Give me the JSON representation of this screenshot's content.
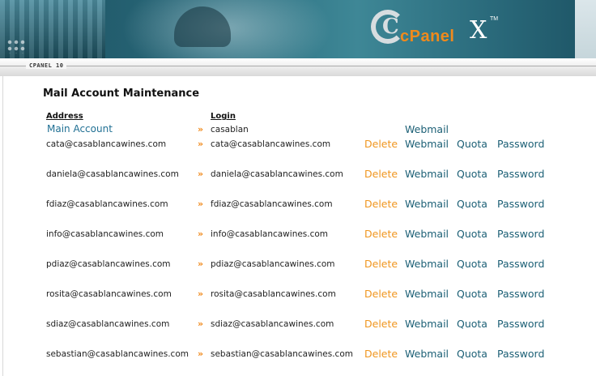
{
  "header": {
    "brand": "cPanel",
    "brand_mark": "C",
    "brand_version_mark": "X",
    "trademark": "TM",
    "version_label": "CPANEL 10"
  },
  "page": {
    "title": "Mail Account Maintenance",
    "col_address": "Address",
    "col_login": "Login"
  },
  "main_account": {
    "label": "Main Account",
    "arrow": "»",
    "login": "casablan",
    "webmail": "Webmail"
  },
  "actions": {
    "arrow": "»",
    "delete": "Delete",
    "webmail": "Webmail",
    "quota": "Quota",
    "password": "Password"
  },
  "accounts": [
    {
      "address": "cata@casablancawines.com",
      "login": "cata@casablancawines.com"
    },
    {
      "address": "daniela@casablancawines.com",
      "login": "daniela@casablancawines.com"
    },
    {
      "address": "fdiaz@casablancawines.com",
      "login": "fdiaz@casablancawines.com"
    },
    {
      "address": "info@casablancawines.com",
      "login": "info@casablancawines.com"
    },
    {
      "address": "pdiaz@casablancawines.com",
      "login": "pdiaz@casablancawines.com"
    },
    {
      "address": "rosita@casablancawines.com",
      "login": "rosita@casablancawines.com"
    },
    {
      "address": "sdiaz@casablancawines.com",
      "login": "sdiaz@casablancawines.com"
    },
    {
      "address": "sebastian@casablancawines.com",
      "login": "sebastian@casablancawines.com"
    }
  ],
  "colors": {
    "delete": "#f0961f",
    "link": "#1b5f75",
    "arrow": "#f08a1c",
    "banner": "#2a6b7c"
  }
}
